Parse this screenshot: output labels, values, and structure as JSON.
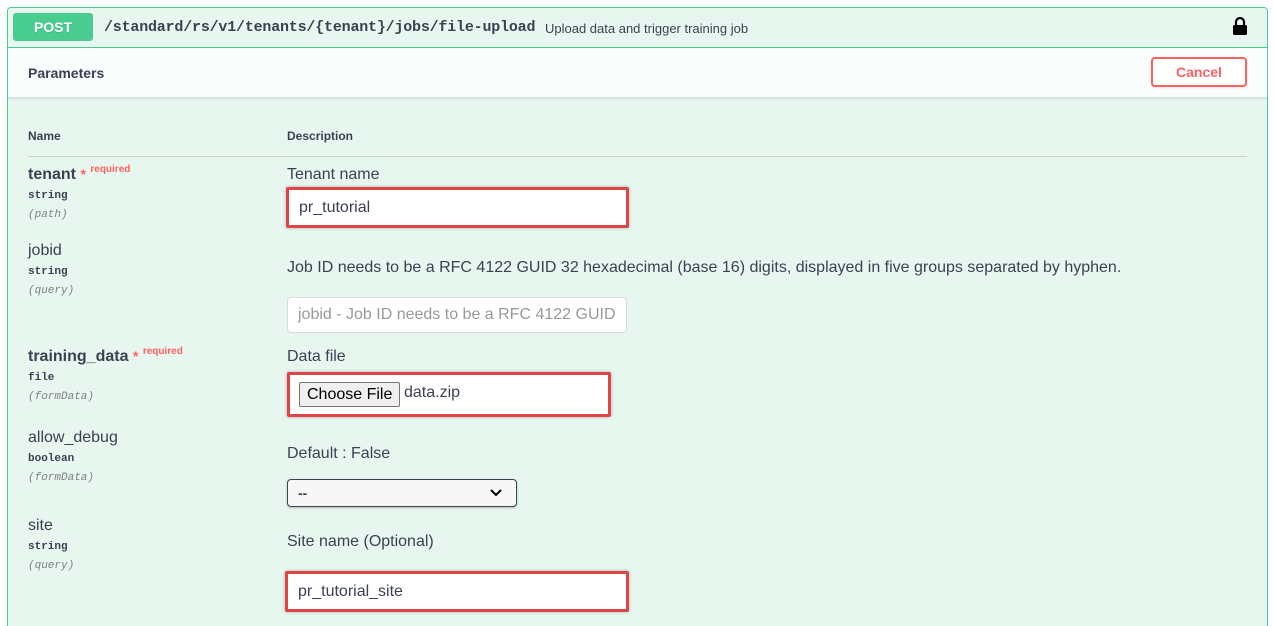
{
  "summary": {
    "method": "POST",
    "path": "/standard/rs/v1/tenants/{tenant}/jobs/file-upload",
    "description": "Upload data and trigger training job",
    "lock_icon": "lock-icon"
  },
  "section": {
    "title": "Parameters",
    "cancel_label": "Cancel"
  },
  "columns": {
    "name": "Name",
    "description": "Description"
  },
  "params": {
    "tenant": {
      "name": "tenant",
      "required_star": "*",
      "required_label": "required",
      "type": "string",
      "in": "(path)",
      "description": "Tenant name",
      "value": "pr_tutorial"
    },
    "jobid": {
      "name": "jobid",
      "type": "string",
      "in": "(query)",
      "description": "Job ID needs to be a RFC 4122 GUID 32 hexadecimal (base 16) digits, displayed in five groups separated by hyphen.",
      "placeholder": "jobid - Job ID needs to be a RFC 4122 GUID"
    },
    "training_data": {
      "name": "training_data",
      "required_star": "*",
      "required_label": "required",
      "type": "file",
      "in": "(formData)",
      "description": "Data file",
      "choose_label": "Choose File",
      "file_name": "data.zip"
    },
    "allow_debug": {
      "name": "allow_debug",
      "type": "boolean",
      "in": "(formData)",
      "description": "Default : False",
      "selected": "--"
    },
    "site": {
      "name": "site",
      "type": "string",
      "in": "(query)",
      "description": "Site name (Optional)",
      "value": "pr_tutorial_site"
    }
  },
  "colors": {
    "post_green": "#49cc90",
    "block_bg": "#e8f6f0",
    "cancel_red": "#ff6060",
    "highlight_red": "#e04545"
  }
}
